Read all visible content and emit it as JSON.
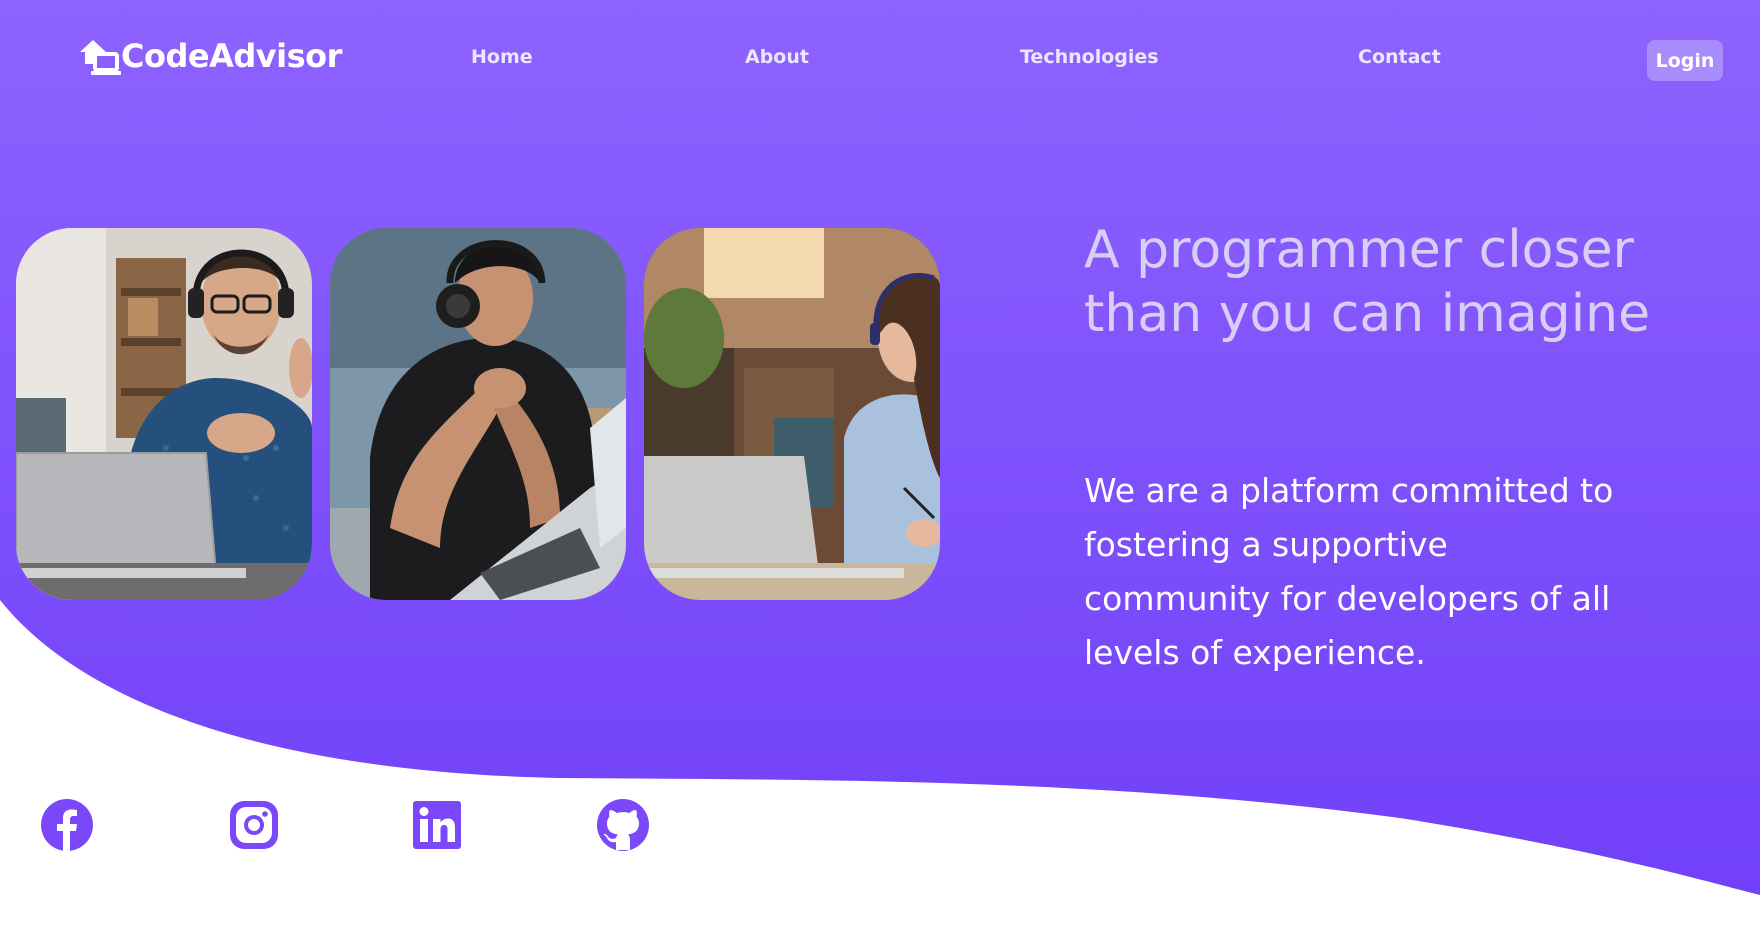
{
  "header": {
    "logo_text": "CodeAdvisor",
    "nav": [
      {
        "label": "Home"
      },
      {
        "label": "About"
      },
      {
        "label": "Technologies"
      },
      {
        "label": "Contact"
      }
    ],
    "login_label": "Login"
  },
  "hero": {
    "title": "A programmer closer than you can imagine",
    "description": "We are a platform committed to fostering a supportive community for developers of all levels of experience.",
    "photos": [
      {
        "icon": "photo-man-headphones-laptop"
      },
      {
        "icon": "photo-man-headphones-thinking"
      },
      {
        "icon": "photo-woman-laptop-cafe"
      }
    ]
  },
  "social": [
    {
      "icon": "facebook-icon"
    },
    {
      "icon": "instagram-icon"
    },
    {
      "icon": "linkedin-icon"
    },
    {
      "icon": "github-icon"
    }
  ],
  "colors": {
    "brand_purple": "#7645fb",
    "brand_purple_light": "#8e63fe",
    "icon_purple": "#7a48f8",
    "title_lavender": "#d9cff5",
    "login_bg": "#a98cfc"
  }
}
